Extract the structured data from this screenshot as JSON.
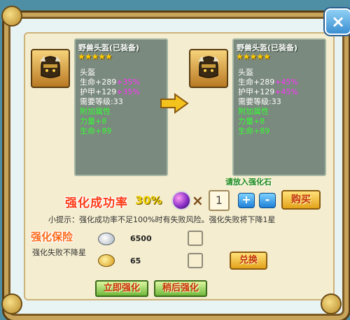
{
  "window": {
    "close_label": "×"
  },
  "item_before": {
    "name": "野兽头盔(已装备)",
    "stars": "★★★★★",
    "type": "头盔",
    "hp": "生命+289",
    "hp_bonus": "+35%",
    "armor": "护甲+129",
    "armor_bonus": "+35%",
    "level_req": "需要等级:33",
    "extra_title": "附加属性",
    "extra_1": "力量+8",
    "extra_2": "生命+89"
  },
  "item_after": {
    "name": "野兽头盔(已装备)",
    "stars": "★★★★★",
    "type": "头盔",
    "hp": "生命+289",
    "hp_bonus": "+45%",
    "armor": "护甲+129",
    "armor_bonus": "+45%",
    "level_req": "需要等级:33",
    "extra_title": "附加属性",
    "extra_1": "力量+8",
    "extra_2": "生命+89"
  },
  "enhance": {
    "rate_label": "强化成功率",
    "rate_value": "30%",
    "times": "×",
    "quantity": "1",
    "place_stone_hint": "请放入强化石",
    "plus": "+",
    "minus": "-",
    "buy_label": "购买",
    "tip": "小提示：强化成功率不足100%时有失败风险。强化失败将下降1星"
  },
  "insurance": {
    "title": "强化保险",
    "desc": "强化失败不降星",
    "silver_amount": "6500",
    "gold_amount": "65",
    "exchange_label": "兑换"
  },
  "actions": {
    "enhance_now": "立即强化",
    "enhance_later": "稍后强化"
  },
  "colors": {
    "accent_red": "#ff3b14",
    "bonus_pink": "#ff33ff",
    "attr_green": "#33ff33",
    "frame_gold": "#c8a45b"
  }
}
